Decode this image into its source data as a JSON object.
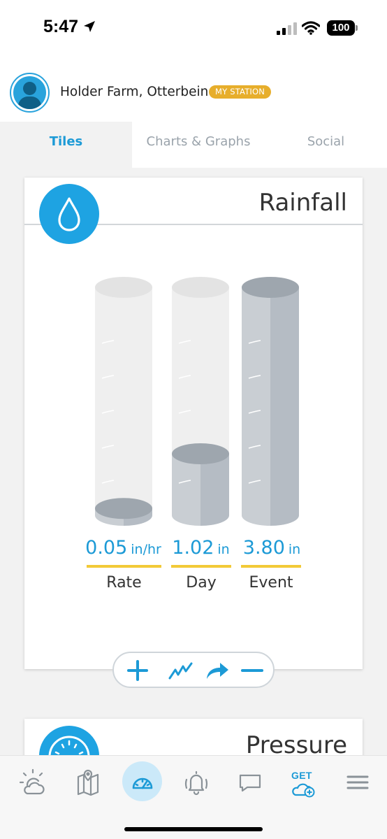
{
  "status_bar": {
    "time": "5:47",
    "battery": "100"
  },
  "station": {
    "name": "Holder Farm, Otterbein",
    "badge": "MY STATION"
  },
  "tabs": [
    {
      "label": "Tiles",
      "active": true
    },
    {
      "label": "Charts & Graphs",
      "active": false
    },
    {
      "label": "Social",
      "active": false
    }
  ],
  "rainfall_tile": {
    "title": "Rainfall",
    "icon": "water-drop-icon",
    "gauges": [
      {
        "value": "0.05",
        "unit": "in/hr",
        "label": "Rate",
        "fill_fraction": 0.03
      },
      {
        "value": "1.02",
        "unit": "in",
        "label": "Day",
        "fill_fraction": 0.27
      },
      {
        "value": "3.80",
        "unit": "in",
        "label": "Event",
        "fill_fraction": 1.0
      }
    ],
    "toolbar": [
      "plus-icon",
      "trend-chart-icon",
      "share-arrow-icon",
      "minus-icon"
    ]
  },
  "pressure_tile": {
    "title": "Pressure",
    "icon": "pressure-gauge-icon"
  },
  "bottom_nav": [
    "weather-icon",
    "map-icon",
    "dashboard-icon",
    "alerts-icon",
    "messages-icon",
    "get-station-icon",
    "menu-icon"
  ],
  "bottom_nav_get_label": "GET",
  "colors": {
    "accent": "#1c9ad6",
    "badge": "#e7ae2b",
    "underline": "#f2ca37",
    "gauge_fill": "#b7bec6"
  }
}
